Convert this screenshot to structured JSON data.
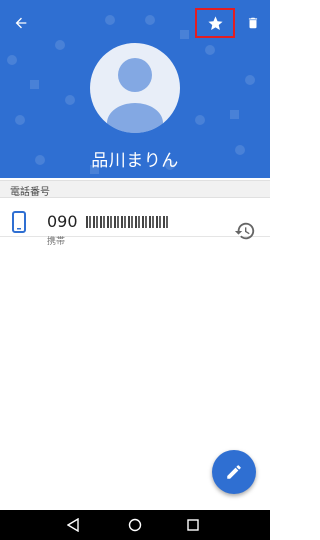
{
  "contact": {
    "name": "品川まりん"
  },
  "sections": {
    "phone_header": "電話番号"
  },
  "phone": {
    "number_visible": "090",
    "type_label": "携帯"
  },
  "colors": {
    "header_bg": "#2f6fd2",
    "highlight_border": "#e31d22",
    "fab_bg": "#2f6fd2"
  },
  "icons": [
    "back-arrow-icon",
    "star-icon",
    "trash-icon",
    "person-icon",
    "phone-icon",
    "history-icon",
    "pencil-icon",
    "nav-back-icon",
    "nav-home-icon",
    "nav-recents-icon"
  ]
}
